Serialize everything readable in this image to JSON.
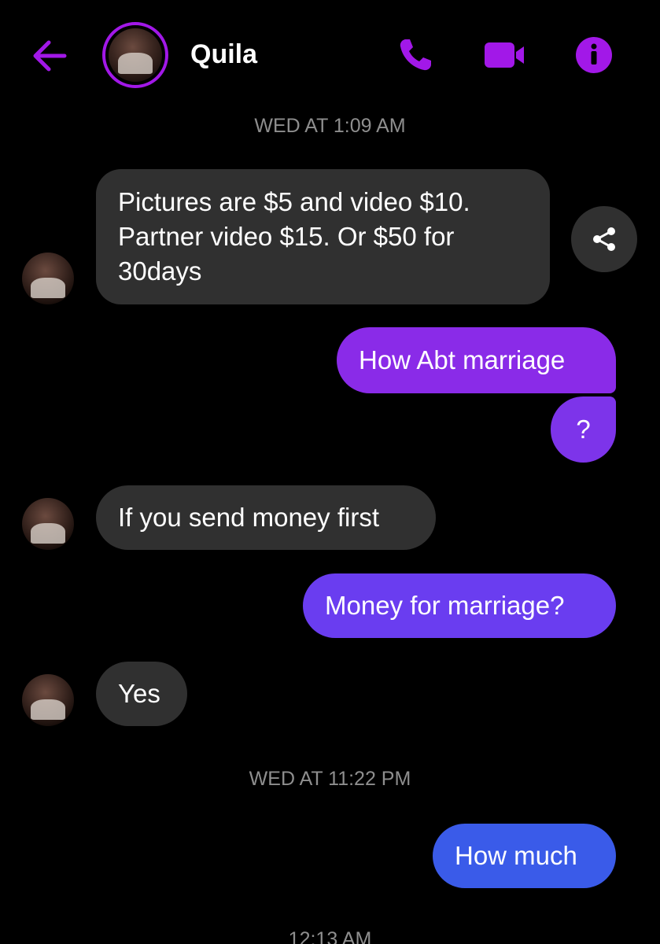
{
  "header": {
    "contact_name": "Quila",
    "accent_color": "#a218e8",
    "icons": [
      "back-arrow-icon",
      "phone-icon",
      "video-camera-icon",
      "info-icon"
    ]
  },
  "timestamps": [
    "WED AT 1:09 AM",
    "WED AT 11:22 PM",
    "12:13 AM"
  ],
  "messages": [
    {
      "from": "contact",
      "text": "Pictures are $5 and video $10. Partner video $15. Or $50 for 30days"
    },
    {
      "from": "me",
      "text": "How Abt marriage"
    },
    {
      "from": "me",
      "text": "?"
    },
    {
      "from": "contact",
      "text": "If you send money first"
    },
    {
      "from": "me",
      "text": "Money for marriage?"
    },
    {
      "from": "contact",
      "text": "Yes"
    },
    {
      "from": "me",
      "text": "How much"
    }
  ],
  "colors": {
    "incoming_bubble": "#303030",
    "outgoing_gradient": [
      "#8a2be8",
      "#7d34ea",
      "#6a3df0",
      "#3a5be9"
    ]
  }
}
